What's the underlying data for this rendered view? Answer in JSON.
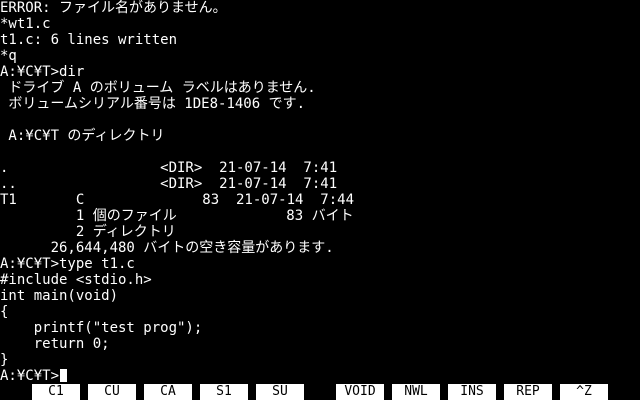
{
  "colors": {
    "background": "#000000",
    "text": "#ffffff",
    "fkey_background": "#ffffff",
    "fkey_text": "#000000"
  },
  "terminal": {
    "lines": [
      "ERROR: ファイル名がありません。",
      "*wt1.c",
      "t1.c: 6 lines written",
      "*q",
      "A:¥C¥T>dir",
      " ドライブ A のボリューム ラベルはありません.",
      " ボリュームシリアル番号は 1DE8-1406 です.",
      "",
      " A:¥C¥T のディレクトリ",
      "",
      ".                  <DIR>  21-07-14  7:41",
      "..                 <DIR>  21-07-14  7:41",
      "T1       C              83  21-07-14  7:44",
      "         1 個のファイル             83 バイト",
      "         2 ディレクトリ",
      "      26,644,480 バイトの空き容量があります.",
      "A:¥C¥T>type t1.c",
      "#include <stdio.h>",
      "int main(void)",
      "{",
      "    printf(\"test prog\");",
      "    return 0;",
      "}"
    ],
    "prompt": "A:¥C¥T>"
  },
  "function_keys": [
    {
      "label": "C1"
    },
    {
      "label": "CU"
    },
    {
      "label": "CA"
    },
    {
      "label": "S1"
    },
    {
      "label": "SU"
    },
    {
      "label": "VOID"
    },
    {
      "label": "NWL"
    },
    {
      "label": "INS"
    },
    {
      "label": "REP"
    },
    {
      "label": "^Z"
    }
  ]
}
